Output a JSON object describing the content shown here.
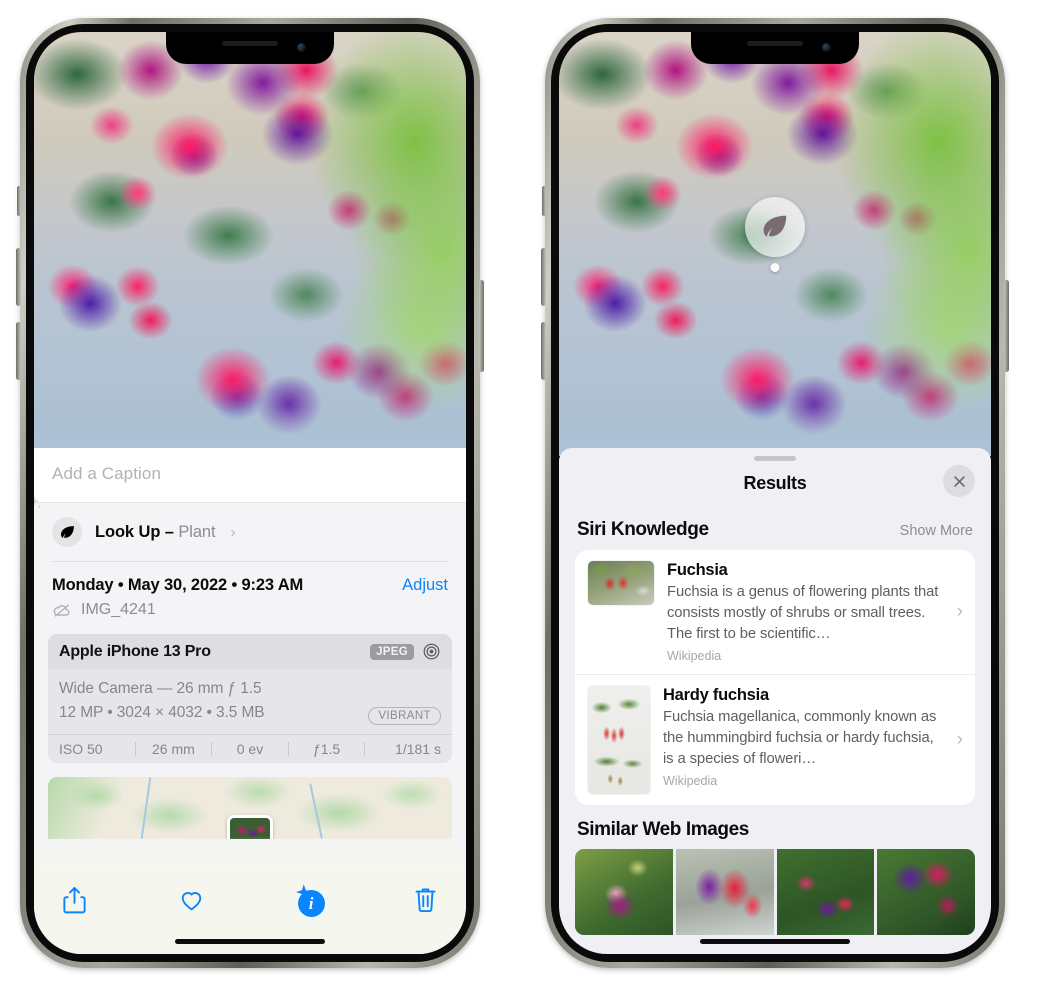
{
  "left_phone": {
    "caption": {
      "placeholder": "Add a Caption",
      "value": ""
    },
    "look_up": {
      "label": "Look Up – ",
      "subject": "Plant",
      "chevron": "›",
      "icon": "leaf-icon"
    },
    "date_line": "Monday • May 30, 2022 • 9:23 AM",
    "adjust_label": "Adjust",
    "file_name": "IMG_4241",
    "cloud_icon": "cloud-slash-icon",
    "camera": {
      "model": "Apple iPhone 13 Pro",
      "format_badge": "JPEG",
      "aperture_icon": "aperture-icon",
      "lens_line": "Wide Camera — 26 mm ƒ 1.5",
      "specs_line": "12 MP • 3024 × 4032 • 3.5 MB",
      "style_pill": "VIBRANT",
      "exif": [
        "ISO 50",
        "26 mm",
        "0 ev",
        "ƒ1.5",
        "1/181 s"
      ]
    },
    "toolbar": {
      "share_label": "share-icon",
      "favorite_label": "heart-icon",
      "info_label": "info-icon",
      "delete_label": "trash-icon",
      "info_glyph": "i"
    }
  },
  "right_phone": {
    "visual_lookup_badge": "leaf-icon",
    "sheet": {
      "title": "Results",
      "close_label": "✕"
    },
    "siri_knowledge": {
      "title": "Siri Knowledge",
      "show_more": "Show More",
      "items": [
        {
          "title": "Fuchsia",
          "description": "Fuchsia is a genus of flowering plants that consists mostly of shrubs or small trees. The first to be scientific…",
          "source": "Wikipedia",
          "chevron": "›"
        },
        {
          "title": "Hardy fuchsia",
          "description": "Fuchsia magellanica, commonly known as the hummingbird fuchsia or hardy fuchsia, is a species of floweri…",
          "source": "Wikipedia",
          "chevron": "›"
        }
      ]
    },
    "similar_web_images": {
      "title": "Similar Web Images",
      "count": 4
    }
  },
  "colors": {
    "accent_blue": "#0a84ff",
    "sheet_bg": "#f0f0f4",
    "card_bg": "#ffffff",
    "muted_text": "#8d8d92"
  }
}
